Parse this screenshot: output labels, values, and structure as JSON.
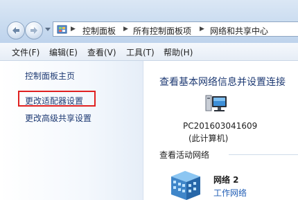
{
  "breadcrumb": {
    "items": [
      "控制面板",
      "所有控制面板项",
      "网络和共享中心"
    ]
  },
  "menu": {
    "items": [
      "文件(F)",
      "编辑(E)",
      "查看(V)",
      "工具(T)",
      "帮助(H)"
    ]
  },
  "sidebar": {
    "links": [
      "控制面板主页",
      "更改适配器设置",
      "更改高级共享设置"
    ],
    "highlighted": "更改适配器设置"
  },
  "main": {
    "title": "查看基本网络信息并设置连接",
    "computer": {
      "name": "PC201603041609",
      "subtitle": "(此计算机)"
    },
    "active_networks_label": "查看活动网络",
    "network": {
      "name": "网络 2",
      "type": "工作网络"
    }
  },
  "colors": {
    "highlight_border": "#e02020",
    "link": "#1e3a73",
    "network_type_link": "#1f5db5"
  },
  "icons": [
    "back-arrow-icon",
    "forward-arrow-icon",
    "recent-pages-icon",
    "control-panel-icon",
    "breadcrumb-separator-icon",
    "computer-icon",
    "network-building-icon"
  ]
}
